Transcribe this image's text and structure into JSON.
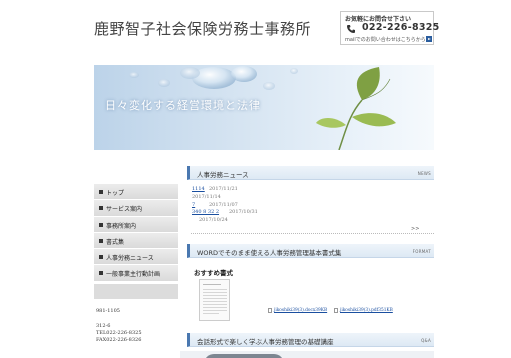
{
  "header": {
    "site_title": "鹿野智子社会保険労務士事務所",
    "contact_heading": "お気軽にお問合せ下さい",
    "phone": "022-226-8325",
    "mail_inquiry": "mailでのお問い合わせはこちらから"
  },
  "hero": {
    "caption": "日々変化する経営環境と法律"
  },
  "sidebar": {
    "items": [
      {
        "label": "トップ"
      },
      {
        "label": "サービス案内"
      },
      {
        "label": "事務所案内"
      },
      {
        "label": "書式集"
      },
      {
        "label": "人事労務ニュース"
      },
      {
        "label": "一般事業主行動計画"
      }
    ],
    "info_lines": [
      "981-1105",
      "312-6",
      "TEL022-226-8325",
      "FAX022-226-8326"
    ]
  },
  "news": {
    "title": "人事労務ニュース",
    "tag": "NEWS",
    "items": [
      {
        "link": "1114",
        "date": "2017/11/21"
      },
      {
        "link": "",
        "date": "2017/11/14"
      },
      {
        "link": "7",
        "date": "2017/11/07"
      },
      {
        "link": "340 8 32 2",
        "date": "2017/10/31"
      },
      {
        "link": "",
        "date": "2017/10/24"
      }
    ],
    "more": ">>"
  },
  "format_section": {
    "title": "WORDでそのまま使える人事労務管理基本書式集",
    "tag": "FORMAT",
    "recommended_heading": "おすすめ書式",
    "files": [
      {
        "name": "jikoshiki39(3).docx39KB"
      },
      {
        "name": "jikoshiki39(3).pdf351KB"
      }
    ]
  },
  "qa_section": {
    "title": "会話形式で楽しく学ぶ人事労務管理の基礎講座",
    "tag": "Q&A",
    "dots": "・・・"
  },
  "colors": {
    "accent": "#4a78b0",
    "link": "#1a4fa0",
    "nav_bg": "#dadada"
  }
}
